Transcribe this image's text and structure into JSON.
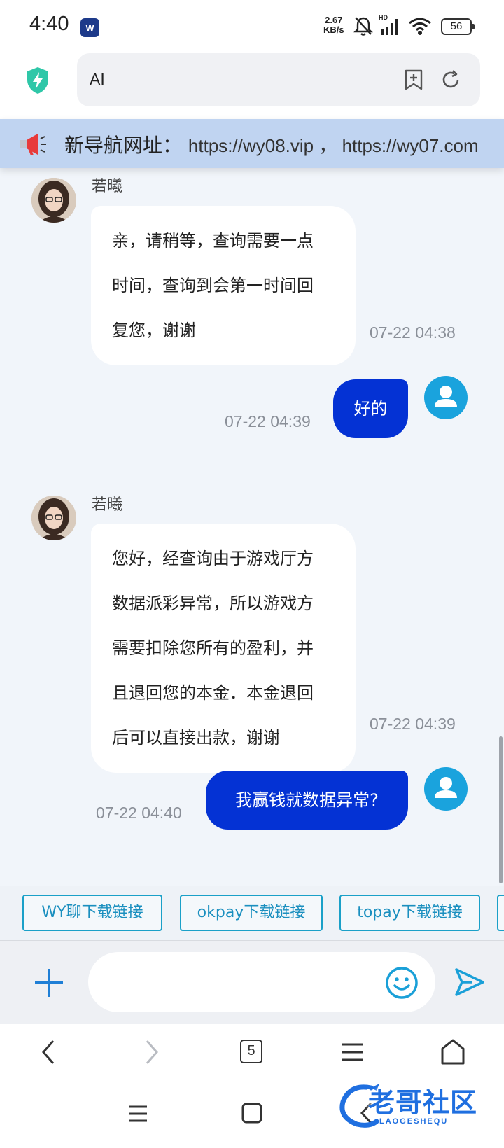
{
  "status_bar": {
    "time": "4:40",
    "app_badge": "W",
    "net_speed_value": "2.67",
    "net_speed_unit": "KB/s",
    "signal_label": "HD",
    "battery": "56"
  },
  "browser": {
    "address": "AI"
  },
  "marquee": {
    "prefix": "新导航网址：",
    "text": "https://wy08.vip ， https://wy07.com"
  },
  "messages": [
    {
      "sender": "若曦",
      "lines": [
        "亲，请稍等，查询需要一点",
        "时间，查询到会第一时间回",
        "复您，谢谢"
      ],
      "time": "07-22 04:38"
    },
    {
      "text": "好的",
      "time": "07-22 04:39"
    },
    {
      "sender": "若曦",
      "lines": [
        "您好，经查询由于游戏厅方",
        "数据派彩异常，所以游戏方",
        "需要扣除您所有的盈利，并",
        "且退回您的本金．本金退回",
        "后可以直接出款，谢谢"
      ],
      "time": "07-22 04:39"
    },
    {
      "text": "我赢钱就数据异常?",
      "time": "07-22 04:40"
    }
  ],
  "quick_links": [
    "WY聊下载链接",
    "okpay下载链接",
    "topay下载链接"
  ],
  "input": {
    "placeholder": ""
  },
  "browser_nav": {
    "tab_count": "5"
  },
  "watermark": {
    "title": "老哥社区",
    "subtitle": "LAOGESHEQU"
  },
  "colors": {
    "accent_blue": "#0432d4",
    "link_teal": "#1aa0c8",
    "marquee_bg": "#c0d4f1",
    "chat_bg": "#f1f5fa",
    "user_avatar": "#1aa3dd"
  }
}
